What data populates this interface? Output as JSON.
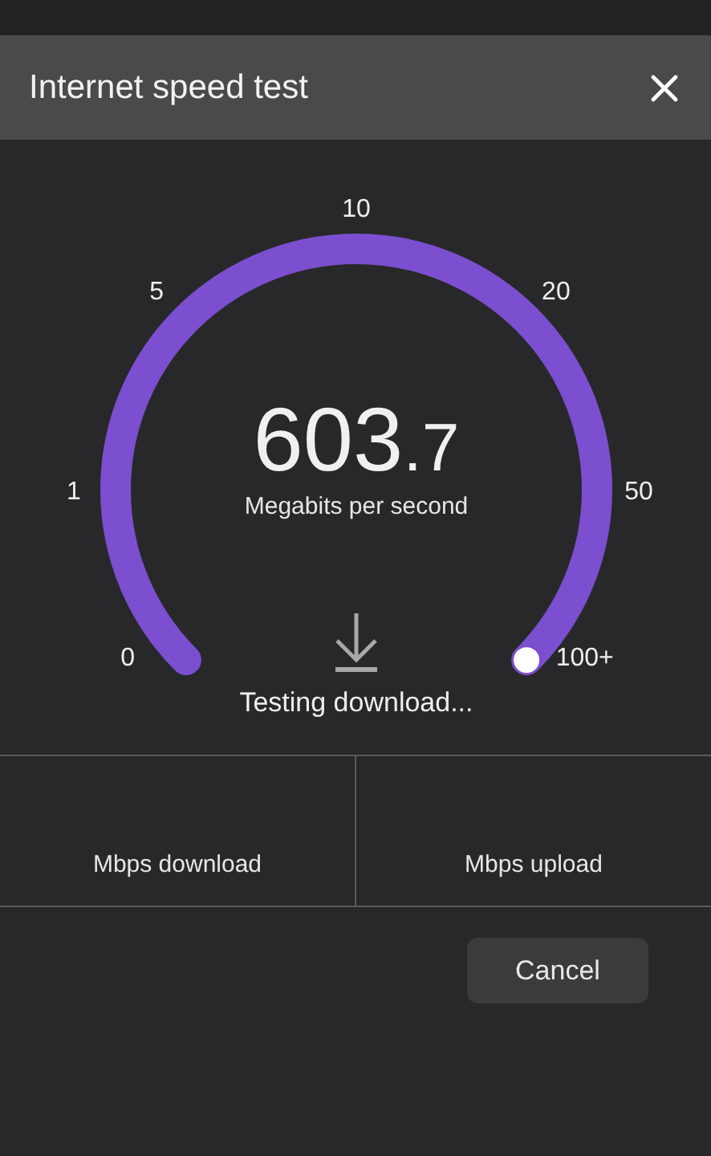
{
  "dialog": {
    "title": "Internet speed test"
  },
  "gauge": {
    "scale_labels": [
      "0",
      "1",
      "5",
      "10",
      "20",
      "50",
      "100+"
    ],
    "reading": {
      "whole": "603",
      "fraction": ".7"
    },
    "unit": "Megabits per second",
    "status": "Testing download..."
  },
  "results": [
    {
      "label": "Mbps download"
    },
    {
      "label": "Mbps upload"
    }
  ],
  "buttons": [
    {
      "label": "Cancel"
    }
  ]
}
